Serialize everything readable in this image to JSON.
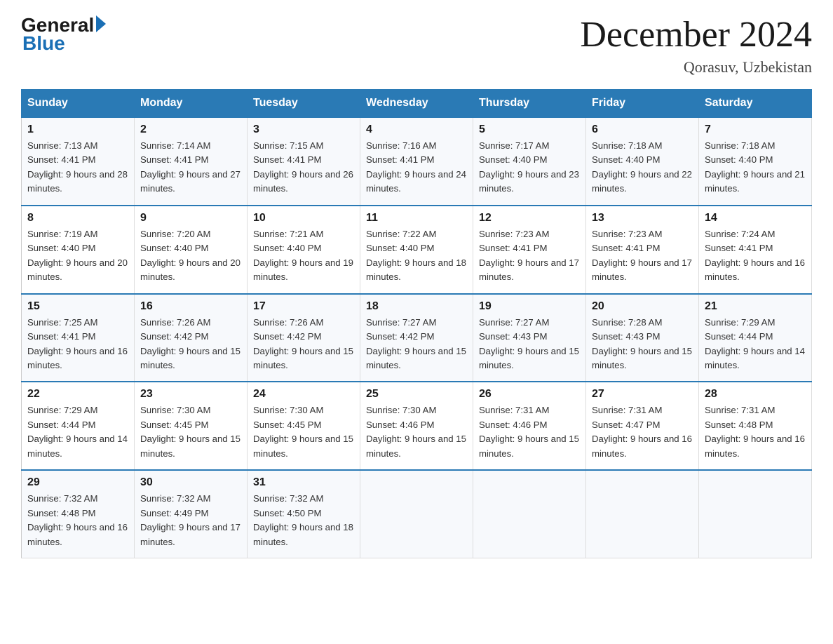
{
  "header": {
    "logo_general": "General",
    "logo_blue": "Blue",
    "month_title": "December 2024",
    "location": "Qorasuv, Uzbekistan"
  },
  "days_of_week": [
    "Sunday",
    "Monday",
    "Tuesday",
    "Wednesday",
    "Thursday",
    "Friday",
    "Saturday"
  ],
  "weeks": [
    [
      {
        "day": "1",
        "sunrise": "7:13 AM",
        "sunset": "4:41 PM",
        "daylight": "9 hours and 28 minutes."
      },
      {
        "day": "2",
        "sunrise": "7:14 AM",
        "sunset": "4:41 PM",
        "daylight": "9 hours and 27 minutes."
      },
      {
        "day": "3",
        "sunrise": "7:15 AM",
        "sunset": "4:41 PM",
        "daylight": "9 hours and 26 minutes."
      },
      {
        "day": "4",
        "sunrise": "7:16 AM",
        "sunset": "4:41 PM",
        "daylight": "9 hours and 24 minutes."
      },
      {
        "day": "5",
        "sunrise": "7:17 AM",
        "sunset": "4:40 PM",
        "daylight": "9 hours and 23 minutes."
      },
      {
        "day": "6",
        "sunrise": "7:18 AM",
        "sunset": "4:40 PM",
        "daylight": "9 hours and 22 minutes."
      },
      {
        "day": "7",
        "sunrise": "7:18 AM",
        "sunset": "4:40 PM",
        "daylight": "9 hours and 21 minutes."
      }
    ],
    [
      {
        "day": "8",
        "sunrise": "7:19 AM",
        "sunset": "4:40 PM",
        "daylight": "9 hours and 20 minutes."
      },
      {
        "day": "9",
        "sunrise": "7:20 AM",
        "sunset": "4:40 PM",
        "daylight": "9 hours and 20 minutes."
      },
      {
        "day": "10",
        "sunrise": "7:21 AM",
        "sunset": "4:40 PM",
        "daylight": "9 hours and 19 minutes."
      },
      {
        "day": "11",
        "sunrise": "7:22 AM",
        "sunset": "4:40 PM",
        "daylight": "9 hours and 18 minutes."
      },
      {
        "day": "12",
        "sunrise": "7:23 AM",
        "sunset": "4:41 PM",
        "daylight": "9 hours and 17 minutes."
      },
      {
        "day": "13",
        "sunrise": "7:23 AM",
        "sunset": "4:41 PM",
        "daylight": "9 hours and 17 minutes."
      },
      {
        "day": "14",
        "sunrise": "7:24 AM",
        "sunset": "4:41 PM",
        "daylight": "9 hours and 16 minutes."
      }
    ],
    [
      {
        "day": "15",
        "sunrise": "7:25 AM",
        "sunset": "4:41 PM",
        "daylight": "9 hours and 16 minutes."
      },
      {
        "day": "16",
        "sunrise": "7:26 AM",
        "sunset": "4:42 PM",
        "daylight": "9 hours and 15 minutes."
      },
      {
        "day": "17",
        "sunrise": "7:26 AM",
        "sunset": "4:42 PM",
        "daylight": "9 hours and 15 minutes."
      },
      {
        "day": "18",
        "sunrise": "7:27 AM",
        "sunset": "4:42 PM",
        "daylight": "9 hours and 15 minutes."
      },
      {
        "day": "19",
        "sunrise": "7:27 AM",
        "sunset": "4:43 PM",
        "daylight": "9 hours and 15 minutes."
      },
      {
        "day": "20",
        "sunrise": "7:28 AM",
        "sunset": "4:43 PM",
        "daylight": "9 hours and 15 minutes."
      },
      {
        "day": "21",
        "sunrise": "7:29 AM",
        "sunset": "4:44 PM",
        "daylight": "9 hours and 14 minutes."
      }
    ],
    [
      {
        "day": "22",
        "sunrise": "7:29 AM",
        "sunset": "4:44 PM",
        "daylight": "9 hours and 14 minutes."
      },
      {
        "day": "23",
        "sunrise": "7:30 AM",
        "sunset": "4:45 PM",
        "daylight": "9 hours and 15 minutes."
      },
      {
        "day": "24",
        "sunrise": "7:30 AM",
        "sunset": "4:45 PM",
        "daylight": "9 hours and 15 minutes."
      },
      {
        "day": "25",
        "sunrise": "7:30 AM",
        "sunset": "4:46 PM",
        "daylight": "9 hours and 15 minutes."
      },
      {
        "day": "26",
        "sunrise": "7:31 AM",
        "sunset": "4:46 PM",
        "daylight": "9 hours and 15 minutes."
      },
      {
        "day": "27",
        "sunrise": "7:31 AM",
        "sunset": "4:47 PM",
        "daylight": "9 hours and 16 minutes."
      },
      {
        "day": "28",
        "sunrise": "7:31 AM",
        "sunset": "4:48 PM",
        "daylight": "9 hours and 16 minutes."
      }
    ],
    [
      {
        "day": "29",
        "sunrise": "7:32 AM",
        "sunset": "4:48 PM",
        "daylight": "9 hours and 16 minutes."
      },
      {
        "day": "30",
        "sunrise": "7:32 AM",
        "sunset": "4:49 PM",
        "daylight": "9 hours and 17 minutes."
      },
      {
        "day": "31",
        "sunrise": "7:32 AM",
        "sunset": "4:50 PM",
        "daylight": "9 hours and 18 minutes."
      },
      null,
      null,
      null,
      null
    ]
  ]
}
